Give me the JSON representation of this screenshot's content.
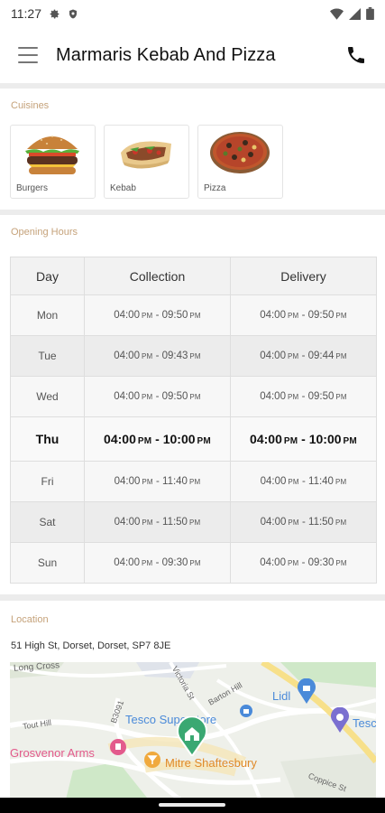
{
  "status_bar": {
    "time": "11:27"
  },
  "header": {
    "title": "Marmaris Kebab And Pizza"
  },
  "cuisines": {
    "title": "Cuisines",
    "items": [
      {
        "label": "Burgers",
        "icon": "burger-icon"
      },
      {
        "label": "Kebab",
        "icon": "kebab-icon"
      },
      {
        "label": "Pizza",
        "icon": "pizza-icon"
      }
    ]
  },
  "opening_hours": {
    "title": "Opening Hours",
    "columns": [
      "Day",
      "Collection",
      "Delivery"
    ],
    "rows": [
      {
        "day": "Mon",
        "collection": {
          "open": "04:00",
          "open_ampm": "PM",
          "close": "09:50",
          "close_ampm": "PM"
        },
        "delivery": {
          "open": "04:00",
          "open_ampm": "PM",
          "close": "09:50",
          "close_ampm": "PM"
        }
      },
      {
        "day": "Tue",
        "collection": {
          "open": "04:00",
          "open_ampm": "PM",
          "close": "09:43",
          "close_ampm": "PM"
        },
        "delivery": {
          "open": "04:00",
          "open_ampm": "PM",
          "close": "09:44",
          "close_ampm": "PM"
        }
      },
      {
        "day": "Wed",
        "collection": {
          "open": "04:00",
          "open_ampm": "PM",
          "close": "09:50",
          "close_ampm": "PM"
        },
        "delivery": {
          "open": "04:00",
          "open_ampm": "PM",
          "close": "09:50",
          "close_ampm": "PM"
        }
      },
      {
        "day": "Thu",
        "collection": {
          "open": "04:00",
          "open_ampm": "PM",
          "close": "10:00",
          "close_ampm": "PM"
        },
        "delivery": {
          "open": "04:00",
          "open_ampm": "PM",
          "close": "10:00",
          "close_ampm": "PM"
        }
      },
      {
        "day": "Fri",
        "collection": {
          "open": "04:00",
          "open_ampm": "PM",
          "close": "11:40",
          "close_ampm": "PM"
        },
        "delivery": {
          "open": "04:00",
          "open_ampm": "PM",
          "close": "11:40",
          "close_ampm": "PM"
        }
      },
      {
        "day": "Sat",
        "collection": {
          "open": "04:00",
          "open_ampm": "PM",
          "close": "11:50",
          "close_ampm": "PM"
        },
        "delivery": {
          "open": "04:00",
          "open_ampm": "PM",
          "close": "11:50",
          "close_ampm": "PM"
        }
      },
      {
        "day": "Sun",
        "collection": {
          "open": "04:00",
          "open_ampm": "PM",
          "close": "09:30",
          "close_ampm": "PM"
        },
        "delivery": {
          "open": "04:00",
          "open_ampm": "PM",
          "close": "09:30",
          "close_ampm": "PM"
        }
      }
    ],
    "highlighted_day": "Thu"
  },
  "location": {
    "title": "Location",
    "address": "51 High St, Dorset, Dorset, SP7 8JE",
    "map_labels": {
      "long_cross": "Long Cross",
      "victoria_st": "Victoria St",
      "barton_hill": "Barton Hill",
      "b3091": "B3091",
      "tout_hill": "Tout Hill",
      "tesco": "Tesco Superstore",
      "lidl": "Lidl",
      "tesco_partial": "Tesc",
      "grosvenor_arms": "Grosvenor Arms",
      "mitre": "Mitre Shaftesbury",
      "coppice_st": "Coppice St"
    }
  },
  "colors": {
    "section_title": "#c5a27a",
    "map_background": "#eef0ea",
    "map_park": "#cfe8c8",
    "map_yellow_road": "#f7e08a",
    "map_blue_poi": "#4a8ad9",
    "map_pink_poi": "#e35a8c",
    "map_orange_poi": "#f0a93d",
    "map_pin": "#3aa872"
  }
}
